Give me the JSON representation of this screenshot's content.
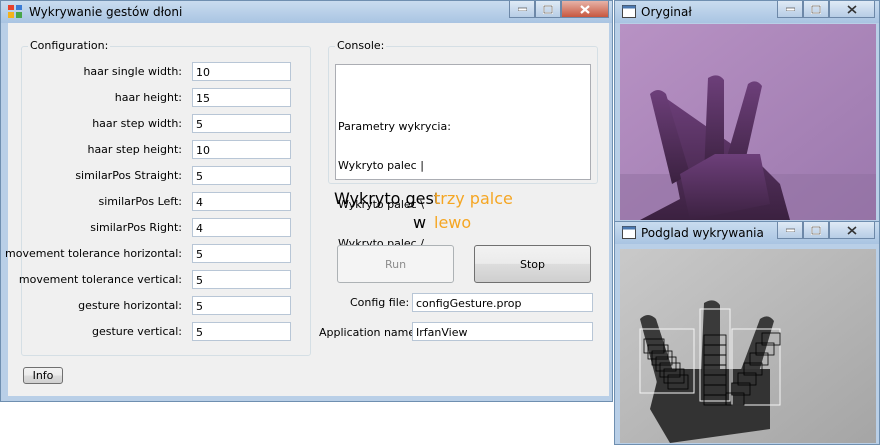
{
  "main_window": {
    "title": "Wykrywanie gestów dłoni",
    "config_group": {
      "title": "Configuration:",
      "fields": [
        {
          "label": "haar single width:",
          "value": "10"
        },
        {
          "label": "haar height:",
          "value": "15"
        },
        {
          "label": "haar step width:",
          "value": "5"
        },
        {
          "label": "haar step height:",
          "value": "10"
        },
        {
          "label": "similarPos Straight:",
          "value": "5"
        },
        {
          "label": "similarPos Left:",
          "value": "4"
        },
        {
          "label": "similarPos Right:",
          "value": "4"
        },
        {
          "label": "movement tolerance horizontal:",
          "value": "5"
        },
        {
          "label": "movement tolerance vertical:",
          "value": "5"
        },
        {
          "label": "gesture horizontal:",
          "value": "5"
        },
        {
          "label": "gesture vertical:",
          "value": "5"
        }
      ]
    },
    "console_group": {
      "title": "Console:",
      "lines": [
        "Parametry wykrycia:",
        "Wykryto palec |",
        "Wykryto palec \\",
        "Wykryto palec /"
      ]
    },
    "detection": {
      "gesture_label": "Wykryto gest",
      "gesture_value": "trzy palce",
      "direction_label": "w",
      "direction_value": "lewo",
      "value_color": "#f5a623"
    },
    "buttons": {
      "run": "Run",
      "stop": "Stop",
      "info": "Info"
    },
    "config_file": {
      "label": "Config file:",
      "value": "configGesture.prop"
    },
    "app_name": {
      "label": "Application name:",
      "value": "IrfanView"
    }
  },
  "original_window": {
    "title": "Oryginał"
  },
  "preview_window": {
    "title": "Podglad wykrywania"
  },
  "icons": [
    "app-icon",
    "window-icon",
    "minimize-icon",
    "maximize-icon",
    "close-icon"
  ]
}
